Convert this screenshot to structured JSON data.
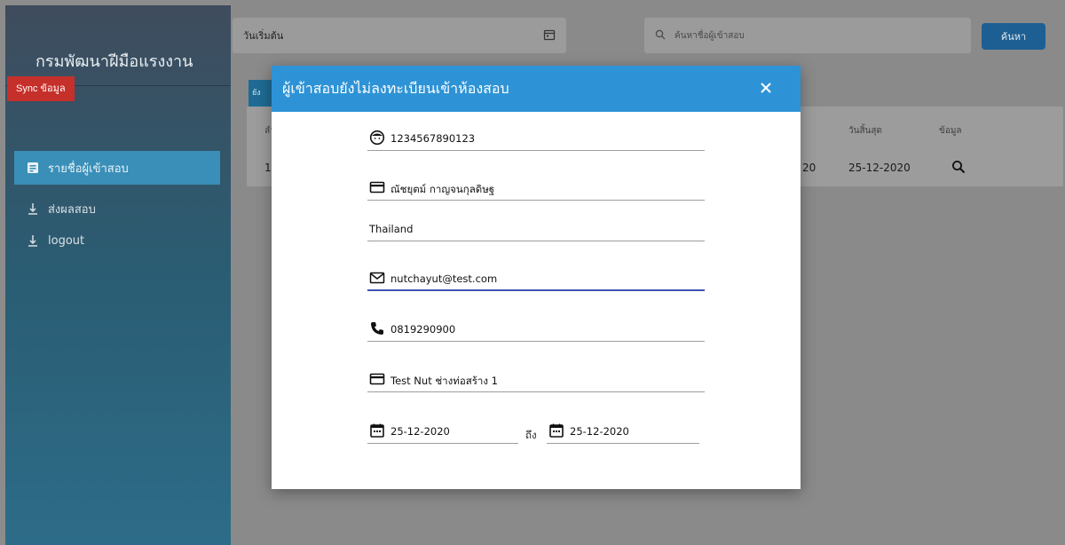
{
  "sidebar": {
    "brand": "กรมพัฒนาฝีมือแรงงาน",
    "sync_label": "Sync ข้อมูล",
    "items": [
      {
        "label": "รายชื่อผู้เข้าสอบ",
        "icon": "badge-icon"
      },
      {
        "label": "ส่งผลสอบ",
        "icon": "download-icon"
      },
      {
        "label": "logout",
        "icon": "download-icon"
      }
    ]
  },
  "toolbar": {
    "start_date_label": "วันเริ่มต้น",
    "search_placeholder": "ค้นหาชื่อผู้เข้าสอบ",
    "search_button": "ค้นหา"
  },
  "table": {
    "tab_stub": "ยัง",
    "headers": [
      "ลำ",
      "วันสิ้นสุด",
      "ข้อมูล"
    ],
    "row": {
      "index": "1",
      "start_fragment": "20",
      "end_date": "25-12-2020"
    }
  },
  "modal": {
    "title": "ผู้เข้าสอบยังไม่ลงทะเบียนเข้าห้องสอบ",
    "fields": {
      "id_number": "1234567890123",
      "name": "ณัชยุตม์ กาญจนกุลดิษฐ",
      "country": "Thailand",
      "email": "nutchayut@test.com",
      "phone": "0819290900",
      "exam": "Test Nut ช่างท่อสร้าง 1",
      "start_date": "25-12-2020",
      "to_label": "ถึง",
      "end_date": "25-12-2020"
    }
  },
  "colors": {
    "modal_header": "#2e93d6",
    "sync_button": "#c6302a",
    "search_button": "#1e5f93",
    "active_nav": "#3a8fb8"
  }
}
